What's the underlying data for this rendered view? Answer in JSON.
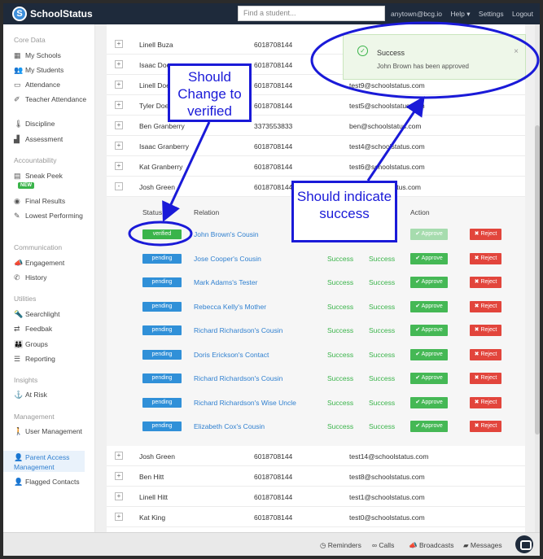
{
  "app": {
    "logo_letter": "S",
    "name": "SchoolStatus"
  },
  "topnav": {
    "search_placeholder": "Find a student...",
    "user": "anytown@bcg.io",
    "help": "Help ▾",
    "settings": "Settings",
    "logout": "Logout"
  },
  "sidebar": {
    "sections": {
      "core": "Core Data",
      "accountability": "Accountability",
      "communication": "Communication",
      "utilities": "Utilities",
      "insights": "Insights",
      "management": "Management"
    },
    "items": {
      "my_schools": "My Schools",
      "my_students": "My Students",
      "attendance": "Attendance",
      "teacher_attendance": "Teacher Attendance",
      "discipline": "Discipline",
      "assessment": "Assessment",
      "sneak_peek": "Sneak Peek",
      "new_badge": "NEW",
      "final_results": "Final Results",
      "lowest_performing": "Lowest Performing",
      "engagement": "Engagement",
      "history": "History",
      "searchlight": "Searchlight",
      "feedback": "Feedbak",
      "groups": "Groups",
      "reporting": "Reporting",
      "at_risk": "At Risk",
      "user_management": "User Management",
      "parent_access_management": "Parent Access Management",
      "flagged_contacts": "Flagged Contacts"
    }
  },
  "rows_top": [
    {
      "name": "Linell Buza",
      "phone": "6018708144",
      "email": ""
    },
    {
      "name": "Isaac Doe",
      "phone": "6018708144",
      "email": ""
    },
    {
      "name": "Linell Doe",
      "phone": "6018708144",
      "email": "test9@schoolstatus.com"
    },
    {
      "name": "Tyler Doe",
      "phone": "6018708144",
      "email": "test5@schoolstatus.com"
    },
    {
      "name": "Ben Granberry",
      "phone": "3373553833",
      "email": "ben@schoolstatus.com"
    },
    {
      "name": "Isaac Granberry",
      "phone": "6018708144",
      "email": "test4@schoolstatus.com"
    },
    {
      "name": "Kat Granberry",
      "phone": "6018708144",
      "email": "test6@schoolstatus.com"
    },
    {
      "name": "Josh Green",
      "phone": "6018708144",
      "email": "test@schoolstatus.com"
    }
  ],
  "expanded": {
    "headers": {
      "status": "Status",
      "relation": "Relation",
      "action": "Action"
    },
    "rows": [
      {
        "status": "verified",
        "relation": "John Brown's Cousin",
        "s1": "",
        "s2": "",
        "approve": "✔ Approve",
        "reject": "✖ Reject"
      },
      {
        "status": "pending",
        "relation": "Jose Cooper's Cousin",
        "s1": "Success",
        "s2": "Success",
        "approve": "✔ Approve",
        "reject": "✖ Reject"
      },
      {
        "status": "pending",
        "relation": "Mark Adams's Tester",
        "s1": "Success",
        "s2": "Success",
        "approve": "✔ Approve",
        "reject": "✖ Reject"
      },
      {
        "status": "pending",
        "relation": "Rebecca Kelly's Mother",
        "s1": "Success",
        "s2": "Success",
        "approve": "✔ Approve",
        "reject": "✖ Reject"
      },
      {
        "status": "pending",
        "relation": "Richard Richardson's Cousin",
        "s1": "Success",
        "s2": "Success",
        "approve": "✔ Approve",
        "reject": "✖ Reject"
      },
      {
        "status": "pending",
        "relation": "Doris Erickson's Contact",
        "s1": "Success",
        "s2": "Success",
        "approve": "✔ Approve",
        "reject": "✖ Reject"
      },
      {
        "status": "pending",
        "relation": "Richard Richardson's Cousin",
        "s1": "Success",
        "s2": "Success",
        "approve": "✔ Approve",
        "reject": "✖ Reject"
      },
      {
        "status": "pending",
        "relation": "Richard Richardson's Wise Uncle",
        "s1": "Success",
        "s2": "Success",
        "approve": "✔ Approve",
        "reject": "✖ Reject"
      },
      {
        "status": "pending",
        "relation": "Elizabeth Cox's Cousin",
        "s1": "Success",
        "s2": "Success",
        "approve": "✔ Approve",
        "reject": "✖ Reject"
      }
    ]
  },
  "rows_bottom": [
    {
      "name": "Josh Green",
      "phone": "6018708144",
      "email": "test14@schoolstatus.com"
    },
    {
      "name": "Ben Hitt",
      "phone": "6018708144",
      "email": "test8@schoolstatus.com"
    },
    {
      "name": "Linell Hitt",
      "phone": "6018708144",
      "email": "test1@schoolstatus.com"
    },
    {
      "name": "Kat King",
      "phone": "6018708144",
      "email": "test0@schoolstatus.com"
    }
  ],
  "toast": {
    "title": "Success",
    "message": "John Brown has been approved",
    "close": "×"
  },
  "bottombar": {
    "reminders": "Reminders",
    "calls": "Calls",
    "broadcasts": "Broadcasts",
    "messages": "Messages"
  },
  "annotations": {
    "change_to_verified": "Should Change to verified",
    "indicate_success": "Should indicate success"
  },
  "colors": {
    "nav": "#1e2a3b",
    "pending": "#3090d8",
    "verified": "#3ab44a",
    "reject": "#e2453c",
    "annotation": "#1a1ad8"
  }
}
